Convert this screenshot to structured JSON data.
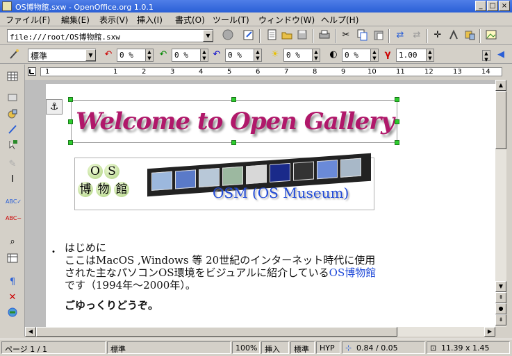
{
  "window": {
    "title": "OS博物館.sxw - OpenOffice.org 1.0.1",
    "controls": {
      "minimize": "_",
      "maximize": "□",
      "close": "×"
    }
  },
  "menu": [
    {
      "label": "ファイル(F)"
    },
    {
      "label": "編集(E)"
    },
    {
      "label": "表示(V)"
    },
    {
      "label": "挿入(I)"
    },
    {
      "label": "書式(O)"
    },
    {
      "label": "ツール(T)"
    },
    {
      "label": "ウィンドウ(W)"
    },
    {
      "label": "ヘルプ(H)"
    }
  ],
  "function_bar": {
    "url_value": "file:///root/OS博物館.sxw",
    "icons": [
      "stop-icon",
      "edit-file-icon",
      "new-document-icon",
      "open-folder-icon",
      "save-icon",
      "print-icon",
      "cut-icon",
      "copy-icon",
      "paste-icon",
      "undo-icon",
      "redo-icon",
      "navigator-icon",
      "stylist-icon",
      "data-sources-icon",
      "gallery-icon"
    ]
  },
  "object_bar": {
    "style_value": "標準",
    "red_value": "0 %",
    "green_value": "0 %",
    "blue_value": "0 %",
    "brightness_value": "0 %",
    "contrast_value": "0 %",
    "gamma_label": "γ",
    "gamma_value": "1.00"
  },
  "ruler": {
    "labels": [
      "1",
      "1",
      "2",
      "3",
      "4",
      "5",
      "6",
      "7",
      "8",
      "9",
      "10",
      "11",
      "12",
      "13",
      "14"
    ]
  },
  "document": {
    "logo_text": "Welcome to Open Gallery",
    "banner": {
      "letters": [
        "O",
        "S"
      ],
      "kanji": [
        "博",
        "物",
        "館"
      ],
      "title": "OSM (OS Museum)"
    },
    "bullet": "・",
    "lines": [
      "はじめに",
      "ここはMacOS ,Windows 等 20世紀のインターネット時代に使用",
      "された主なパソコンOS環境をビジュアルに紹介している",
      "OS博物館",
      "です（1994年〜2000年）。",
      "ごゆっくりどうぞ。"
    ]
  },
  "status": {
    "page": "ページ 1 / 1",
    "style": "標準",
    "zoom": "100%",
    "insert_mode": "挿入",
    "selection_mode": "標準",
    "hyperlink_mode": "HYP",
    "position": "0.84 / 0.05",
    "size": "11.39 x 1.45"
  },
  "colors": {
    "titlebar": "#2a5fd6",
    "logo": "#b0186a",
    "banner_text": "#1f49d8",
    "handle": "#2ecc2e"
  }
}
